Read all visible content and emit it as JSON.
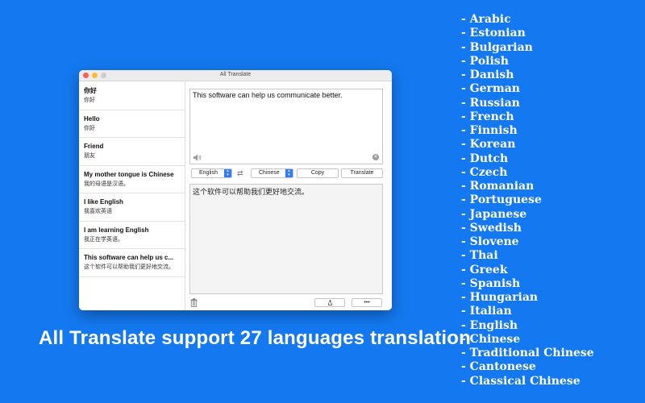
{
  "window": {
    "title": "All Translate"
  },
  "history": [
    {
      "title": "你好",
      "sub": "你好"
    },
    {
      "title": "Hello",
      "sub": "你好"
    },
    {
      "title": "Friend",
      "sub": "朋友"
    },
    {
      "title": "My mother tongue is Chinese",
      "sub": "我的母语是汉语。"
    },
    {
      "title": "I like English",
      "sub": "我喜欢英语"
    },
    {
      "title": "I am learning English",
      "sub": "我正在学英语。"
    },
    {
      "title": "This software can help us c...",
      "sub": "这个软件可以帮助我们更好地交流。"
    }
  ],
  "source": {
    "text": "This software can help us communicate better."
  },
  "toolbar": {
    "source_lang": "English",
    "target_lang": "Chinese",
    "copy_label": "Copy",
    "translate_label": "Translate"
  },
  "result": {
    "text": "这个软件可以帮助我们更好地交流。"
  },
  "bottom": {
    "more_label": "•••"
  },
  "tagline": "All Translate support 27 languages translation",
  "languages": [
    "- Arabic",
    "- Estonian",
    "- Bulgarian",
    "- Polish",
    "- Danish",
    "- German",
    "- Russian",
    "- French",
    "- Finnish",
    "- Korean",
    "- Dutch",
    "- Czech",
    "- Romanian",
    "- Portuguese",
    "- Japanese",
    "- Swedish",
    "- Slovene",
    "- Thai",
    "- Greek",
    "- Spanish",
    "- Hungarian",
    "- Italian",
    "- English",
    "- Chinese",
    "- Traditional Chinese",
    "- Cantonese",
    "- Classical Chinese"
  ],
  "colors": {
    "background": "#1479f0",
    "accent": "#2f7cf6"
  }
}
